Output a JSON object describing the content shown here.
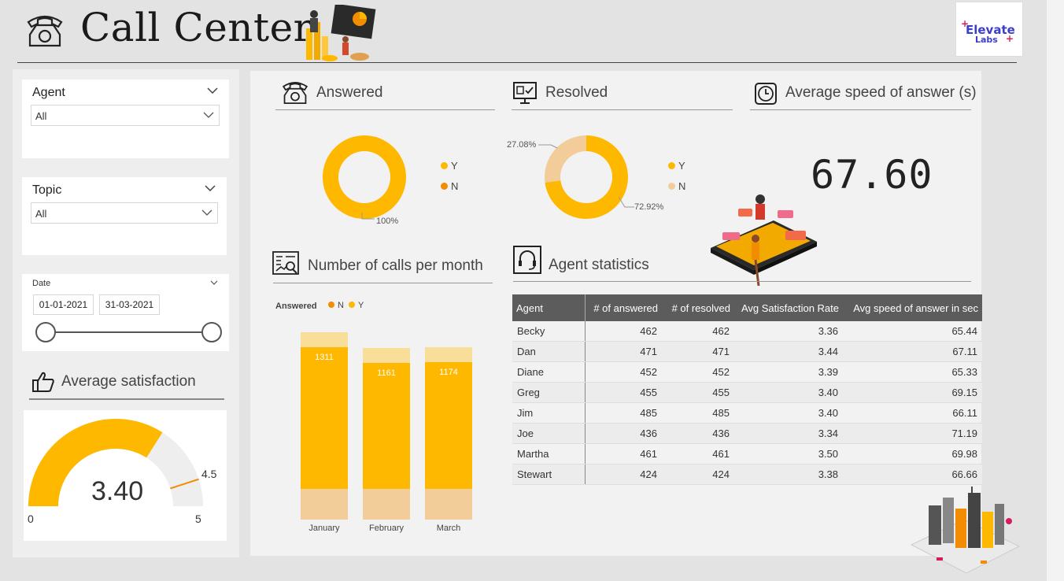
{
  "header": {
    "title": "Call Center",
    "logo_line1": "Elevate",
    "logo_line2": "Labs"
  },
  "filters": {
    "agent": {
      "title": "Agent",
      "value": "All"
    },
    "topic": {
      "title": "Topic",
      "value": "All"
    },
    "date": {
      "title": "Date",
      "start": "01-01-2021",
      "end": "31-03-2021"
    }
  },
  "satisfaction": {
    "title": "Average satisfaction",
    "value": "3.40",
    "min": "0",
    "max": "5",
    "target": "4.5"
  },
  "answered": {
    "title": "Answered",
    "legend": [
      "Y",
      "N"
    ],
    "label": "100%"
  },
  "resolved": {
    "title": "Resolved",
    "legend": [
      "Y",
      "N"
    ],
    "label_y": "72.92%",
    "label_n": "27.08%"
  },
  "speed": {
    "title": "Average speed of answer (s)",
    "value": "67.60"
  },
  "calls": {
    "title": "Number of calls per month",
    "legend_title": "Answered",
    "legend": [
      "N",
      "Y"
    ]
  },
  "agent_stats": {
    "title": "Agent statistics",
    "columns": [
      "Agent",
      "# of answered",
      "# of resolved",
      "Avg Satisfaction Rate",
      "Avg speed of answer in sec"
    ],
    "rows": [
      [
        "Becky",
        "462",
        "462",
        "3.36",
        "65.44"
      ],
      [
        "Dan",
        "471",
        "471",
        "3.44",
        "67.11"
      ],
      [
        "Diane",
        "452",
        "452",
        "3.39",
        "65.33"
      ],
      [
        "Greg",
        "455",
        "455",
        "3.40",
        "69.15"
      ],
      [
        "Jim",
        "485",
        "485",
        "3.40",
        "66.11"
      ],
      [
        "Joe",
        "436",
        "436",
        "3.34",
        "71.19"
      ],
      [
        "Martha",
        "461",
        "461",
        "3.50",
        "69.98"
      ],
      [
        "Stewart",
        "424",
        "424",
        "3.38",
        "66.66"
      ]
    ]
  },
  "colors": {
    "accent": "#ffb800",
    "accent_light": "#f2cc99",
    "accent_pale": "#f8de99",
    "orange": "#f28c00",
    "table_header": "#5c5c5c"
  },
  "chart_data": [
    {
      "type": "pie",
      "title": "Answered",
      "categories": [
        "Y",
        "N"
      ],
      "values": [
        100,
        0
      ]
    },
    {
      "type": "pie",
      "title": "Resolved",
      "categories": [
        "Y",
        "N"
      ],
      "values": [
        72.92,
        27.08
      ]
    },
    {
      "type": "bar",
      "title": "Number of calls per month",
      "categories": [
        "January",
        "February",
        "March"
      ],
      "series": [
        {
          "name": "Y",
          "values": [
            1311,
            1161,
            1174
          ]
        }
      ],
      "legend": [
        "N",
        "Y"
      ],
      "legend_title": "Answered"
    }
  ]
}
